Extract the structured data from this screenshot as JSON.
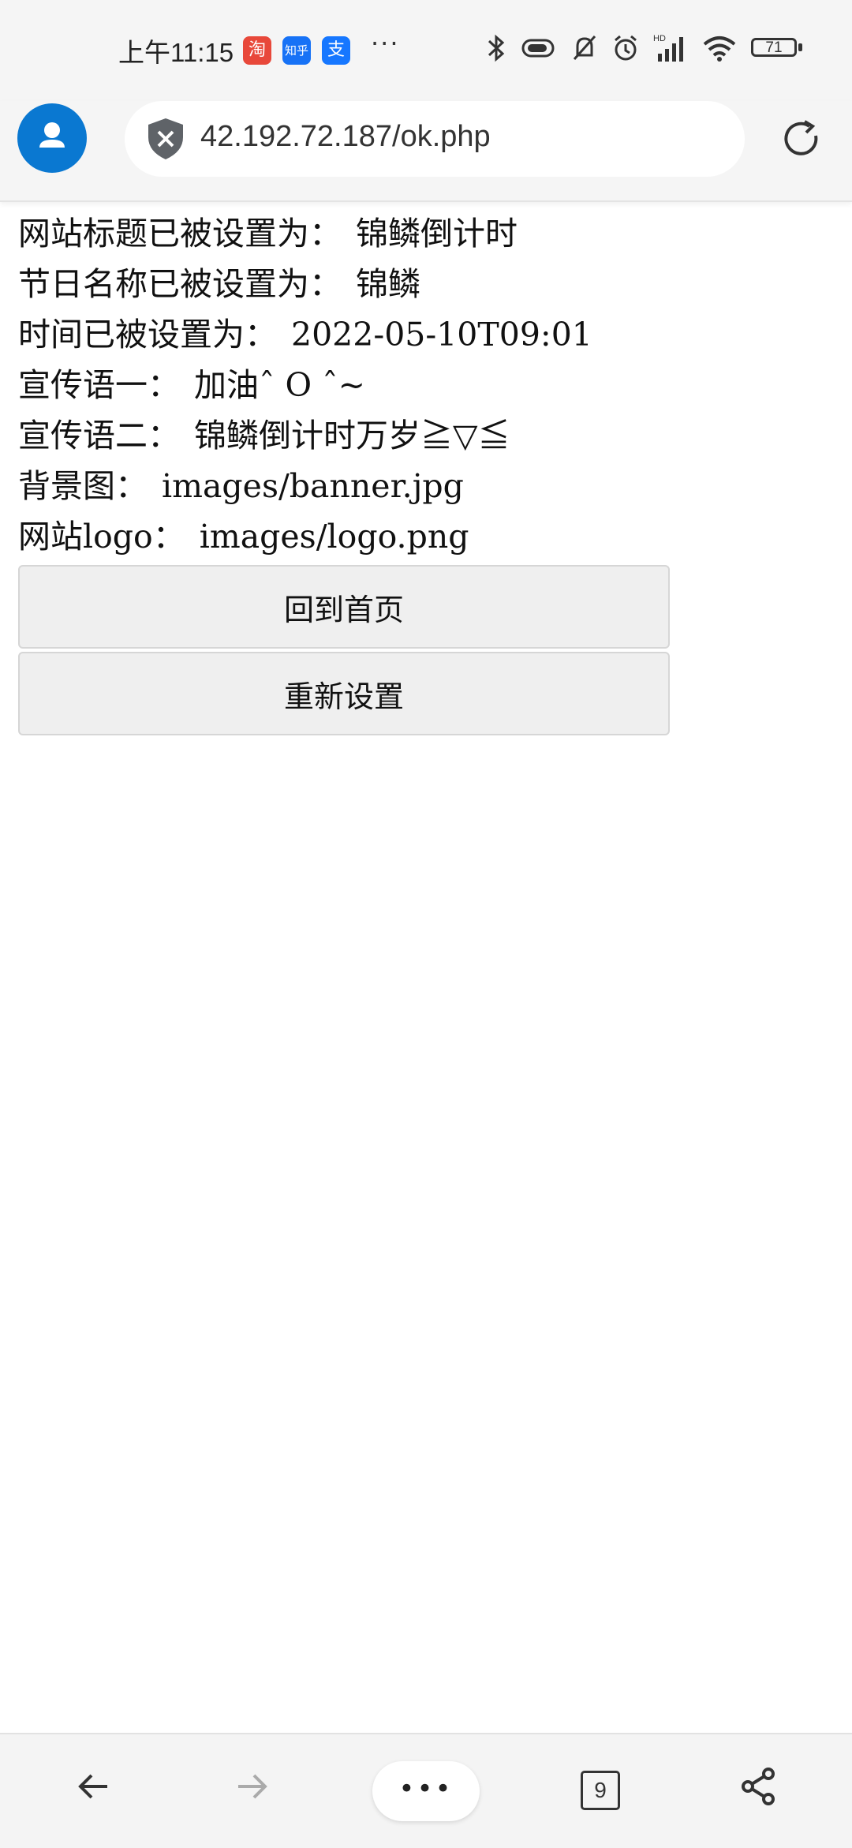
{
  "status_bar": {
    "time": "上午11:15",
    "app_icons": [
      "淘",
      "知乎",
      "支"
    ],
    "more": "···",
    "battery": "71",
    "network_label": "HD"
  },
  "browser": {
    "url": "42.192.72.187/ok.php",
    "tab_count": "9",
    "accent": "#0a78d1"
  },
  "settings_result": [
    {
      "label": "网站标题已被设置为：",
      "value": "锦鳞倒计时"
    },
    {
      "label": "节日名称已被设置为：",
      "value": "锦鳞"
    },
    {
      "label": "时间已被设置为：",
      "value": "2022-05-10T09:01"
    },
    {
      "label": "宣传语一：",
      "value": "加油ˆ O ˆ~"
    },
    {
      "label": "宣传语二：",
      "value": "锦鳞倒计时万岁≧▽≦"
    },
    {
      "label": "背景图：",
      "value": "images/banner.jpg"
    },
    {
      "label": "网站logo：",
      "value": "images/logo.png"
    }
  ],
  "buttons": {
    "home": "回到首页",
    "reset": "重新设置"
  },
  "bottom_nav": {
    "menu": "•••"
  }
}
